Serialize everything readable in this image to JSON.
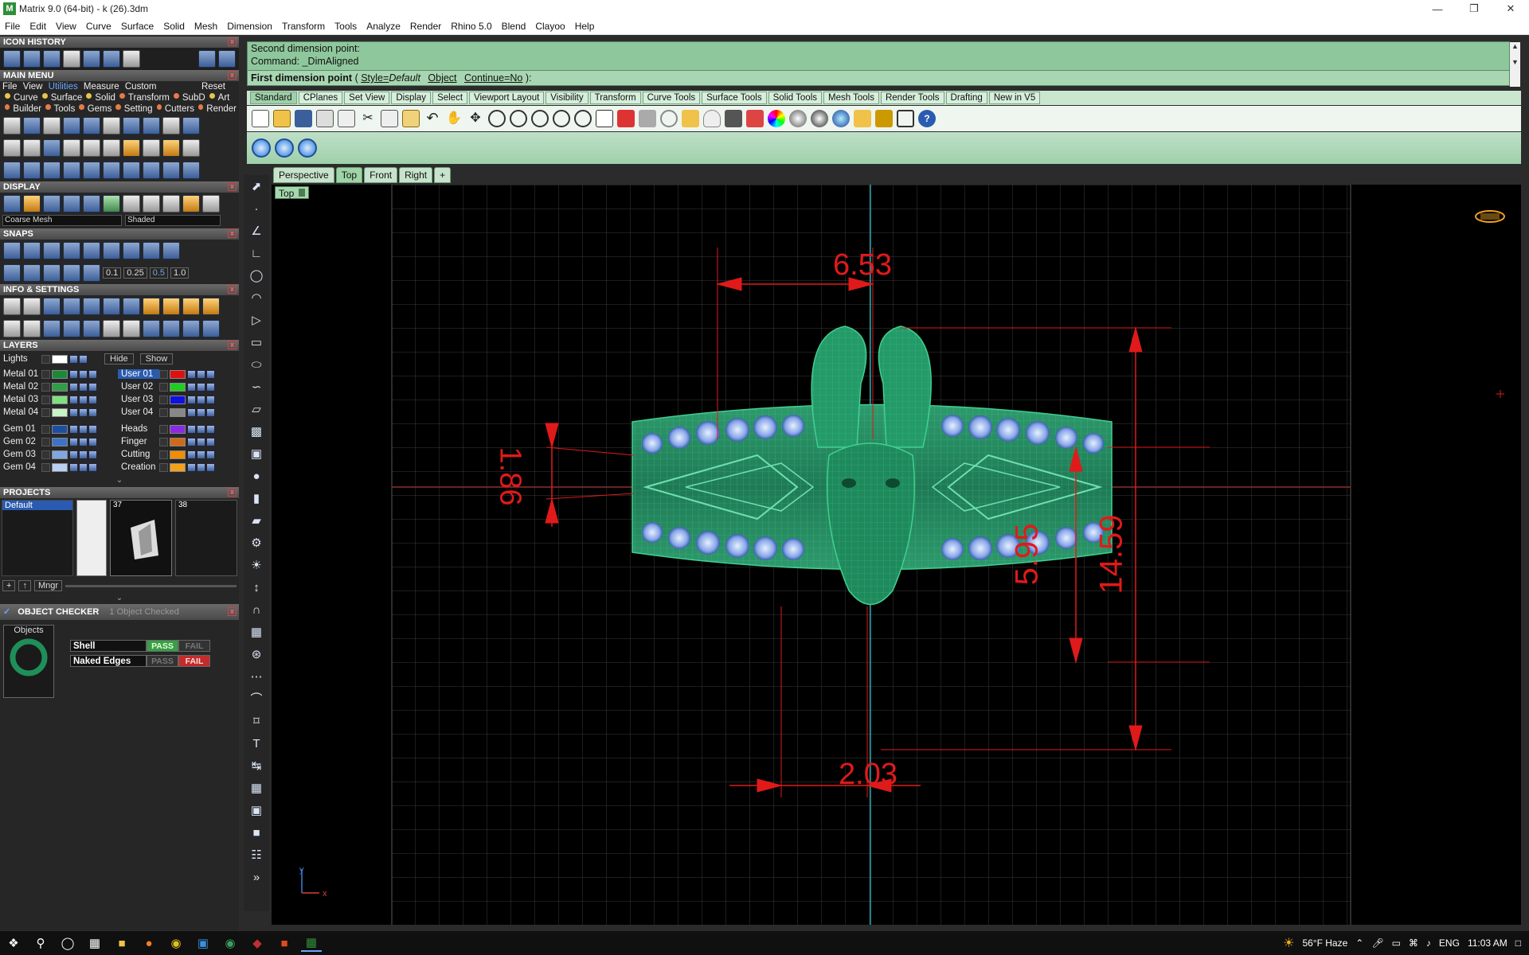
{
  "window": {
    "title": "Matrix 9.0 (64-bit) - k (26).3dm",
    "app_icon_letter": "M"
  },
  "menu": [
    "File",
    "Edit",
    "View",
    "Curve",
    "Surface",
    "Solid",
    "Mesh",
    "Dimension",
    "Transform",
    "Tools",
    "Analyze",
    "Render",
    "Rhino 5.0",
    "Blend",
    "Clayoo",
    "Help"
  ],
  "panels": {
    "icon_history": "ICON HISTORY",
    "main_menu": "MAIN MENU",
    "main_menu_tabs": [
      "File",
      "View",
      "Utilities",
      "Measure",
      "Custom"
    ],
    "main_menu_reset": "Reset",
    "mm_row1": [
      "Curve",
      "Surface",
      "Solid",
      "Transform",
      "SubD",
      "Art"
    ],
    "mm_row2": [
      "Builder",
      "Tools",
      "Gems",
      "Setting",
      "Cutters",
      "Render"
    ],
    "display": "DISPLAY",
    "display_mesh": "Coarse Mesh",
    "display_mode": "Shaded",
    "snaps": "SNAPS",
    "snap_values": [
      "0.1",
      "0.25",
      "0.5",
      "1.0"
    ],
    "info_settings": "INFO & SETTINGS",
    "layers": "LAYERS",
    "lights": "Lights",
    "hide": "Hide",
    "show": "Show",
    "layers_left": [
      "Metal 01",
      "Metal 02",
      "Metal 03",
      "Metal 04",
      "Gem 01",
      "Gem 02",
      "Gem 03",
      "Gem 04"
    ],
    "layers_left_colors": [
      "#1a8a3a",
      "#2f9e46",
      "#7ee07e",
      "#c8f2c8",
      "#1c4fa0",
      "#3d73c6",
      "#7fa6e0",
      "#b8d0f4"
    ],
    "layers_right": [
      "User 01",
      "User 02",
      "User 03",
      "User 04",
      "Heads",
      "Finger",
      "Cutting",
      "Creation"
    ],
    "layers_right_colors": [
      "#e01010",
      "#22cc22",
      "#1010e0",
      "#888888",
      "#8a2be2",
      "#d06a1a",
      "#f28c00",
      "#f4a21a"
    ],
    "projects": "PROJECTS",
    "project_default": "Default",
    "project_numbers": [
      "37",
      "38"
    ],
    "mngr": "Mngr",
    "object_checker": "OBJECT CHECKER",
    "objects_checked": "1 Object Checked",
    "objects_label": "Objects",
    "checks": [
      {
        "name": "Shell",
        "pass": "PASS",
        "fail": "FAIL"
      },
      {
        "name": "Naked Edges",
        "pass": "PASS",
        "fail": "FAIL"
      }
    ]
  },
  "command": {
    "line1": "Second dimension point:",
    "line2": "Command: _DimAligned",
    "prompt_label": "First dimension point",
    "prompt_style": "Style=",
    "prompt_style_value": "Default",
    "prompt_object": "Object",
    "prompt_continue": "Continue=No",
    "prompt_end": "):"
  },
  "toolbar_tabs": [
    "Standard",
    "CPlanes",
    "Set View",
    "Display",
    "Select",
    "Viewport Layout",
    "Visibility",
    "Transform",
    "Curve Tools",
    "Surface Tools",
    "Solid Tools",
    "Mesh Tools",
    "Render Tools",
    "Drafting",
    "New in V5"
  ],
  "viewport_tabs": [
    "Perspective",
    "Top",
    "Front",
    "Right"
  ],
  "viewport_label": "Top",
  "dimensions": {
    "top_width": "6.53",
    "left_height": "1.86",
    "inner_height": "5.95",
    "total_height": "14.59",
    "bottom_width": "2.03"
  },
  "axis": {
    "x": "x",
    "y": "y"
  },
  "taskbar": {
    "weather": "56°F Haze",
    "lang": "ENG",
    "time": "11:03 AM"
  }
}
